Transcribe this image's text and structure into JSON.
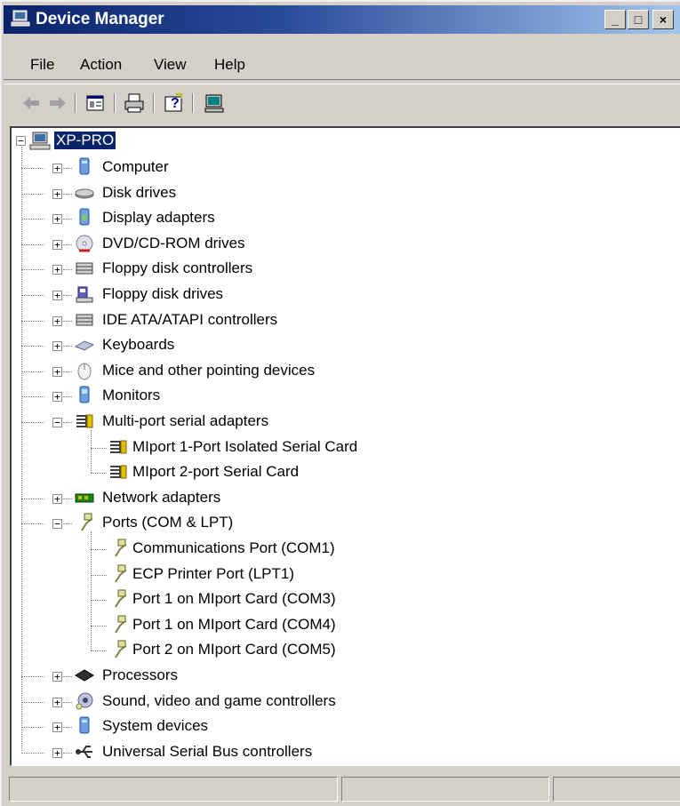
{
  "window": {
    "title": "Device Manager",
    "controls": {
      "minimize": "_",
      "maximize": "□",
      "close": "×"
    }
  },
  "menu": [
    "File",
    "Action",
    "View",
    "Help"
  ],
  "toolbar": {
    "buttons": [
      "back-arrow-icon",
      "forward-arrow-icon",
      "properties-icon",
      "print-icon",
      "help-icon",
      "scan-hardware-icon"
    ]
  },
  "tree": {
    "root": "XP-PRO",
    "items": [
      {
        "label": "Computer",
        "icon": "computer-icon"
      },
      {
        "label": "Disk drives",
        "icon": "disk-drive-icon"
      },
      {
        "label": "Display adapters",
        "icon": "display-adapter-icon"
      },
      {
        "label": "DVD/CD-ROM drives",
        "icon": "cd-rom-icon"
      },
      {
        "label": "Floppy disk controllers",
        "icon": "controller-icon"
      },
      {
        "label": "Floppy disk drives",
        "icon": "floppy-drive-icon"
      },
      {
        "label": "IDE ATA/ATAPI controllers",
        "icon": "controller-icon"
      },
      {
        "label": "Keyboards",
        "icon": "keyboard-icon"
      },
      {
        "label": "Mice and other pointing devices",
        "icon": "mouse-icon"
      },
      {
        "label": "Monitors",
        "icon": "monitor-icon"
      },
      {
        "label": "Multi-port serial adapters",
        "icon": "serial-adapter-icon",
        "children": [
          "MIport 1-Port Isolated Serial Card",
          "MIport 2-port Serial Card"
        ]
      },
      {
        "label": "Network adapters",
        "icon": "network-adapter-icon"
      },
      {
        "label": "Ports (COM & LPT)",
        "icon": "port-icon",
        "children": [
          "Communications Port (COM1)",
          "ECP Printer Port (LPT1)",
          "Port 1 on MIport Card (COM3)",
          "Port 1 on MIport Card (COM4)",
          "Port 2 on MIport Card (COM5)"
        ]
      },
      {
        "label": "Processors",
        "icon": "processor-icon"
      },
      {
        "label": "Sound, video and game controllers",
        "icon": "sound-icon"
      },
      {
        "label": "System devices",
        "icon": "system-devices-icon"
      },
      {
        "label": "Universal Serial Bus controllers",
        "icon": "usb-icon"
      }
    ]
  },
  "colors": {
    "selection": "#0a246a",
    "titlebar_start": "#0a246a",
    "titlebar_end": "#a6caf0"
  }
}
